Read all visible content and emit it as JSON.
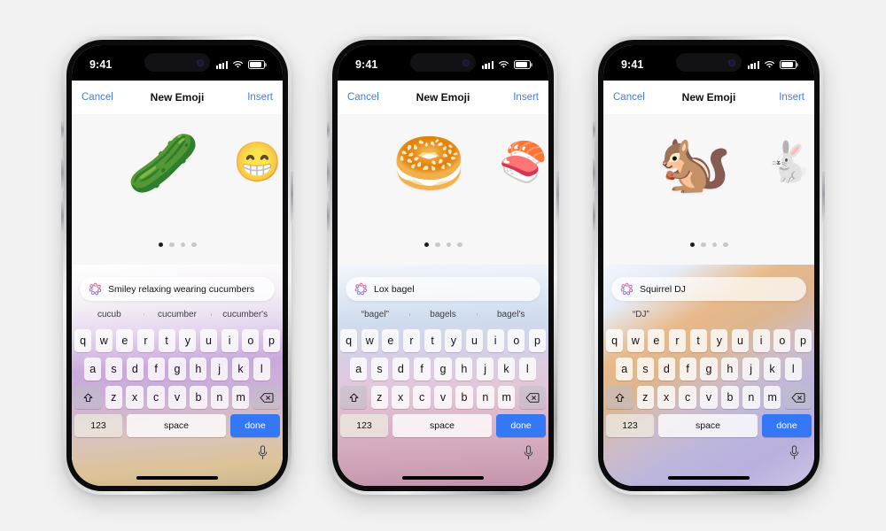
{
  "scene": {
    "background_color": "#f2f2f2",
    "device_count": 3
  },
  "status_bar": {
    "time": "9:41",
    "signal_icon": "cellular-signal-icon",
    "wifi_icon": "wifi-icon",
    "battery_icon": "battery-icon"
  },
  "nav": {
    "cancel_label": "Cancel",
    "title": "New Emoji",
    "insert_label": "Insert",
    "accent_color": "#3c7cf0"
  },
  "keyboard": {
    "row1": [
      "q",
      "w",
      "e",
      "r",
      "t",
      "y",
      "u",
      "i",
      "o",
      "p"
    ],
    "row2": [
      "a",
      "s",
      "d",
      "f",
      "g",
      "h",
      "j",
      "k",
      "l"
    ],
    "row3": [
      "z",
      "x",
      "c",
      "v",
      "b",
      "n",
      "m"
    ],
    "shift_icon": "shift-arrow-icon",
    "backspace_icon": "backspace-delete-icon",
    "numbers_label": "123",
    "space_label": "space",
    "done_label": "done",
    "done_color": "#3478f6",
    "mic_icon": "microphone-icon"
  },
  "page_dots": {
    "count": 4,
    "active_index": 0
  },
  "genmoji_icon_name": "apple-intelligence-genmoji-icon",
  "phones": [
    {
      "id": "phone-cucumber",
      "prompt": "Smiley relaxing wearing cucumbers",
      "emoji_main": "🥒",
      "emoji_main_name": "smiley-with-cucumber-slices",
      "emoji_peek": "😁",
      "emoji_peek_name": "grinning-face-with-cucumbers",
      "suggestions": [
        "cucub",
        "cucumber",
        "cucumber's"
      ],
      "gradient": "linear-gradient(176deg, #ffffff 0%, #f6f2f7 16%, #e6d9ef 30%, #c9a9dd 46%, #cdb0d8 58%, #d9c3b9 76%, #dcc397 90%, #cbb68f 100%)"
    },
    {
      "id": "phone-bagel",
      "prompt": "Lox bagel",
      "emoji_main": "🥯",
      "emoji_main_name": "lox-bagel",
      "emoji_peek": "🍣",
      "emoji_peek_name": "bagel-with-lox-half",
      "suggestions": [
        "“bagel”",
        "bagels",
        "bagel's"
      ],
      "gradient": "linear-gradient(178deg, #f3f6fa 0%, #dfe9f5 14%, #cfdcee 26%, #d6cfe6 40%, #e2c7d8 56%, #dbb4c6 72%, #cfa3b8 88%, #c294ab 100%)"
    },
    {
      "id": "phone-squirrel",
      "prompt": "Squirrel DJ",
      "emoji_main": "🐿️",
      "emoji_main_name": "squirrel-dj-with-turntables",
      "emoji_peek": "🐇",
      "emoji_peek_name": "squirrel-dj-half",
      "suggestions": [
        "“DJ”"
      ],
      "gradient": "linear-gradient(150deg, #f2f5fb 0%, #e6ecf6 14%, #e8b98a 30%, #ddb68f 42%, #cdbcc9 56%, #bcb6dd 70%, #b9b0dd 84%, #cdc3e4 100%)"
    }
  ]
}
